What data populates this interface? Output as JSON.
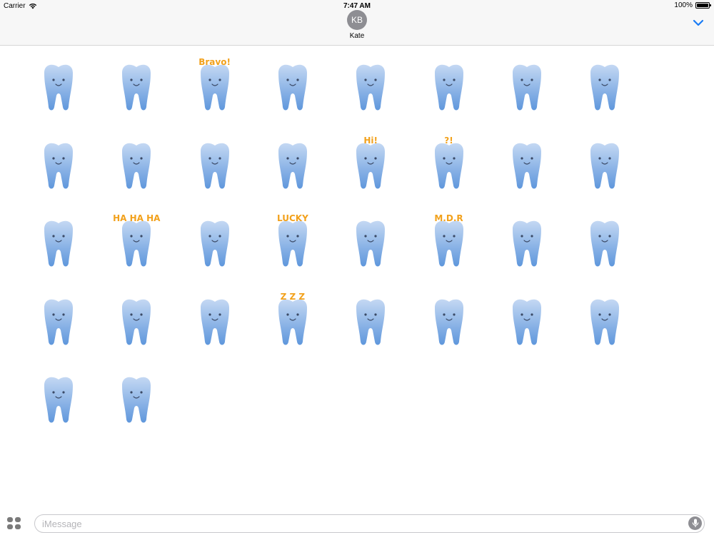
{
  "status_bar": {
    "carrier": "Carrier",
    "time": "7:47 AM",
    "battery_percent": "100%",
    "battery_level": 1.0
  },
  "conversation": {
    "avatar_initials": "KB",
    "contact_name": "Kate",
    "collapse_icon": "chevron-down-icon",
    "accent_color": "#1a7cf5"
  },
  "stickers": [
    {
      "caption": ""
    },
    {
      "caption": ""
    },
    {
      "caption": "Bravo!"
    },
    {
      "caption": ""
    },
    {
      "caption": ""
    },
    {
      "caption": ""
    },
    {
      "caption": ""
    },
    {
      "caption": ""
    },
    {
      "caption": ""
    },
    {
      "caption": ""
    },
    {
      "caption": ""
    },
    {
      "caption": ""
    },
    {
      "caption": "Hi!"
    },
    {
      "caption": "?!"
    },
    {
      "caption": ""
    },
    {
      "caption": ""
    },
    {
      "caption": ""
    },
    {
      "caption": "HA HA HA"
    },
    {
      "caption": ""
    },
    {
      "caption": "LUCKY"
    },
    {
      "caption": ""
    },
    {
      "caption": "M.D.R"
    },
    {
      "caption": ""
    },
    {
      "caption": ""
    },
    {
      "caption": ""
    },
    {
      "caption": ""
    },
    {
      "caption": ""
    },
    {
      "caption": "Z Z Z"
    },
    {
      "caption": ""
    },
    {
      "caption": ""
    },
    {
      "caption": ""
    },
    {
      "caption": ""
    },
    {
      "caption": ""
    },
    {
      "caption": ""
    }
  ],
  "message_input": {
    "placeholder": "iMessage",
    "value": ""
  },
  "icons": {
    "apps": "app-drawer-icon",
    "mic": "microphone-icon",
    "wifi": "wifi-icon",
    "battery": "battery-icon"
  },
  "colors": {
    "tooth_light": "#c4d8f3",
    "tooth_dark": "#5f97dc",
    "sticker_accent": "#f2a11c"
  }
}
